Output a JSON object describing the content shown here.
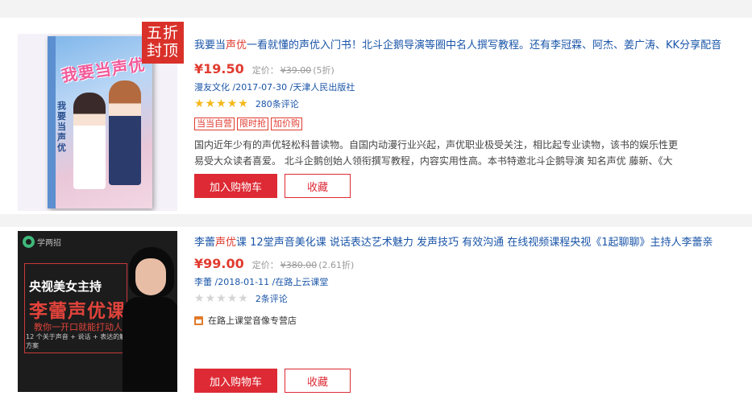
{
  "items": [
    {
      "cover": {
        "book_title": "我要当声优",
        "side_text": "我要当声优",
        "badge": [
          "五折",
          "封顶"
        ]
      },
      "title": {
        "before": "我要当",
        "highlight": "声优",
        "after": "一看就懂的声优入门书！北斗企鹅导演等圈中名人撰写教程。还有李冠霖、阿杰、姜广涛、KK分享配音"
      },
      "price": "¥19.50",
      "list_price_label": "定价：",
      "list_price": "¥39.00",
      "discount": "(5折)",
      "publication": "漫友文化 /2017-07-30 /天津人民出版社",
      "rating": {
        "stars_filled": 5,
        "stars_total": 5,
        "reviews": "280条评论"
      },
      "tags": [
        "当当自营",
        "限时抢",
        "加价购"
      ],
      "description": [
        "国内近年少有的声优轻松科普读物。自国内动漫行业兴起，声优职业极受关注，相比起专业读物，该书的娱乐性更",
        "易受大众读者喜爱。 北斗企鹅创始人领衔撰写教程，内容实用性高。本书特邀北斗企鹅导演 知名声优 藤新、《大"
      ],
      "buttons": {
        "cart": "加入购物车",
        "favorite": "收藏"
      }
    },
    {
      "cover": {
        "logo": "学两招",
        "line1": "央视美女主持",
        "line2": "李蕾声优课",
        "line3": "教你一开口就能打动人心",
        "line4": "12 个关于声音 + 说话 + 表达的解决方案"
      },
      "title": {
        "before": "李蕾",
        "highlight": "声优",
        "after": "课 12堂声音美化课 说话表达艺术魅力 发声技巧 有效沟通 在线视频课程央视《1起聊聊》主持人李蕾亲"
      },
      "price": "¥99.00",
      "list_price_label": "定价：",
      "list_price": "¥380.00",
      "discount": "(2.61折)",
      "publication": "李蕾 /2018-01-11 /在路上云课堂",
      "rating": {
        "stars_filled": 0,
        "stars_total": 5,
        "reviews": "2条评论"
      },
      "shop": "在路上课堂音像专营店",
      "buttons": {
        "cart": "加入购物车",
        "favorite": "收藏"
      }
    }
  ],
  "colors": {
    "accent_red": "#dd2a34",
    "price_red": "#e13b30",
    "link_blue": "#1a55a8",
    "star_gold": "#f5b719",
    "star_grey": "#d4d4d4"
  }
}
